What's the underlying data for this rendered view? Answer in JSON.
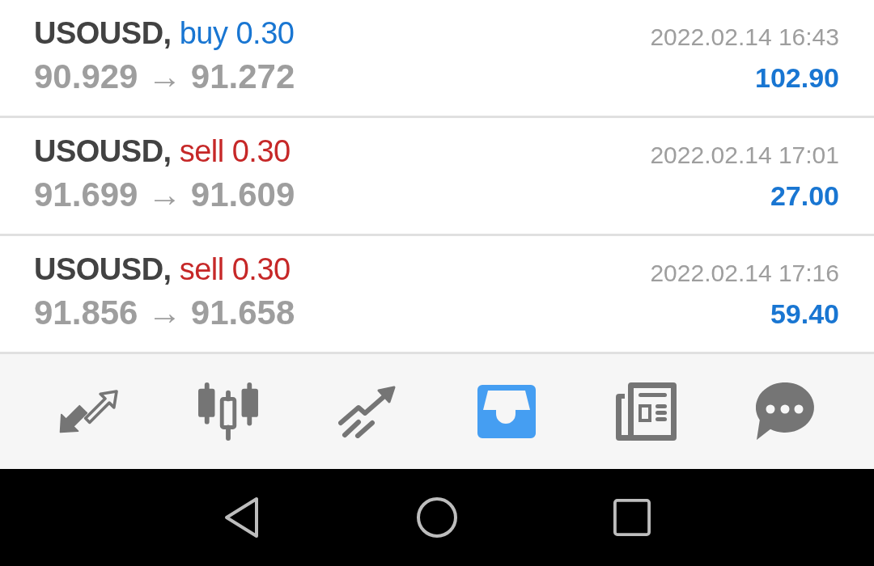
{
  "trades": [
    {
      "symbol": "USOUSD,",
      "kind": "buy",
      "order": "buy 0.30",
      "prices": "90.929 → 91.272",
      "time": "2022.02.14 16:43",
      "profit": "102.90"
    },
    {
      "symbol": "USOUSD,",
      "kind": "sell",
      "order": "sell 0.30",
      "prices": "91.699 → 91.609",
      "time": "2022.02.14 17:01",
      "profit": "27.00"
    },
    {
      "symbol": "USOUSD,",
      "kind": "sell",
      "order": "sell 0.30",
      "prices": "91.856 → 91.658",
      "time": "2022.02.14 17:16",
      "profit": "59.40"
    }
  ],
  "tabs": [
    {
      "selected": false
    },
    {
      "selected": false
    },
    {
      "selected": false
    },
    {
      "selected": true
    },
    {
      "selected": false
    },
    {
      "selected": false
    }
  ]
}
